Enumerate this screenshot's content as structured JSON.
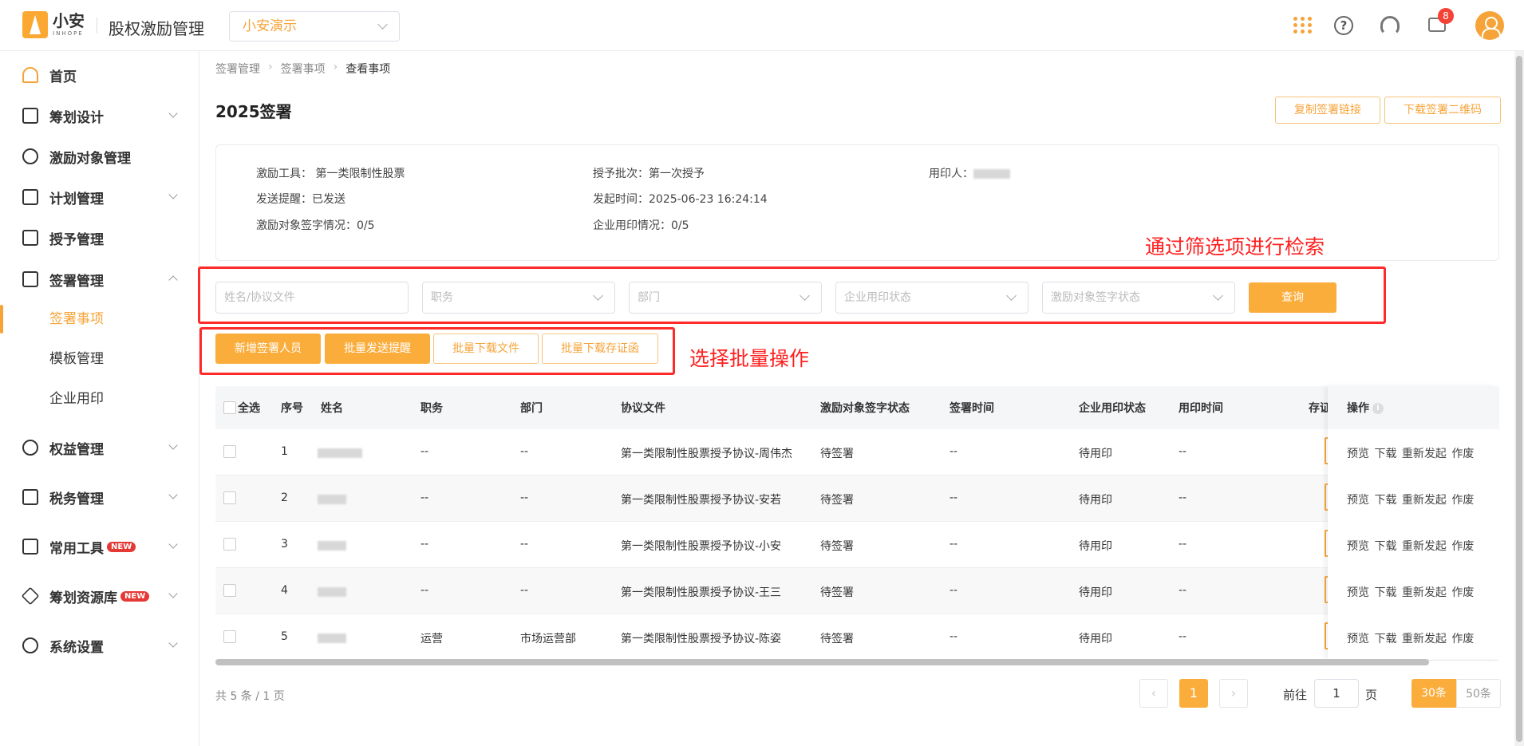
{
  "header": {
    "logo_cn": "小安",
    "logo_en": "INHOPE",
    "app_title": "股权激励管理",
    "company": "小安演示",
    "message_badge": "8"
  },
  "sidebar": {
    "items": [
      {
        "label": "首页"
      },
      {
        "label": "筹划设计"
      },
      {
        "label": "激励对象管理"
      },
      {
        "label": "计划管理"
      },
      {
        "label": "授予管理"
      },
      {
        "label": "签署管理"
      },
      {
        "label": "权益管理"
      },
      {
        "label": "税务管理"
      },
      {
        "label": "常用工具"
      },
      {
        "label": "筹划资源库"
      },
      {
        "label": "系统设置"
      }
    ],
    "sub_items": [
      {
        "label": "签署事项"
      },
      {
        "label": "模板管理"
      },
      {
        "label": "企业用印"
      }
    ],
    "new_tag": "NEW"
  },
  "breadcrumb": [
    "签署管理",
    "签署事项",
    "查看事项"
  ],
  "page": {
    "title": "2025签署",
    "copy_link_label": "复制签署链接",
    "download_qr_label": "下载签署二维码"
  },
  "info": {
    "tool": "激励工具：  第一类限制性股票",
    "batch": "授予批次：第一次授予",
    "seal_user": "用印人：",
    "reminder": "发送提醒：已发送",
    "start_time": "发起时间：2025-06-23 16:24:14",
    "sign_status": "激励对象签字情况：0/5",
    "seal_status": "企业用印情况：0/5"
  },
  "annotations": {
    "filter_note": "通过筛选项进行检索",
    "batch_note": "选择批量操作"
  },
  "filters": {
    "name_placeholder": "姓名/协议文件",
    "position_placeholder": "职务",
    "department_placeholder": "部门",
    "seal_status_placeholder": "企业用印状态",
    "sign_status_placeholder": "激励对象签字状态",
    "query_label": "查询"
  },
  "actions": {
    "add_signer": "新增签署人员",
    "batch_remind": "批量发送提醒",
    "batch_download_files": "批量下载文件",
    "batch_download_certs": "批量下载存证函"
  },
  "table": {
    "columns": [
      "全选",
      "序号",
      "姓名",
      "职务",
      "部门",
      "协议文件",
      "激励对象签字状态",
      "签署时间",
      "企业用印状态",
      "用印时间",
      "存证",
      "操作"
    ],
    "rows": [
      {
        "no": "1",
        "position": "--",
        "department": "--",
        "file": "第一类限制性股票授予协议-周伟杰",
        "sign_status": "待签署",
        "sign_time": "--",
        "seal_status": "待用印",
        "seal_time": "--"
      },
      {
        "no": "2",
        "position": "--",
        "department": "--",
        "file": "第一类限制性股票授予协议-安若",
        "sign_status": "待签署",
        "sign_time": "--",
        "seal_status": "待用印",
        "seal_time": "--"
      },
      {
        "no": "3",
        "position": "--",
        "department": "--",
        "file": "第一类限制性股票授予协议-小安",
        "sign_status": "待签署",
        "sign_time": "--",
        "seal_status": "待用印",
        "seal_time": "--"
      },
      {
        "no": "4",
        "position": "--",
        "department": "--",
        "file": "第一类限制性股票授予协议-王三",
        "sign_status": "待签署",
        "sign_time": "--",
        "seal_status": "待用印",
        "seal_time": "--"
      },
      {
        "no": "5",
        "position": "运营",
        "department": "市场运营部",
        "file": "第一类限制性股票授予协议-陈姿",
        "sign_status": "待签署",
        "sign_time": "--",
        "seal_status": "待用印",
        "seal_time": "--"
      }
    ],
    "row_ops": "预览 下载 重新发起 作废"
  },
  "pagination": {
    "summary": "共 5 条 / 1 页",
    "current_page": "1",
    "goto_label": "前往",
    "goto_value": "1",
    "page_unit": "页",
    "size_30": "30条",
    "size_50": "50条"
  }
}
